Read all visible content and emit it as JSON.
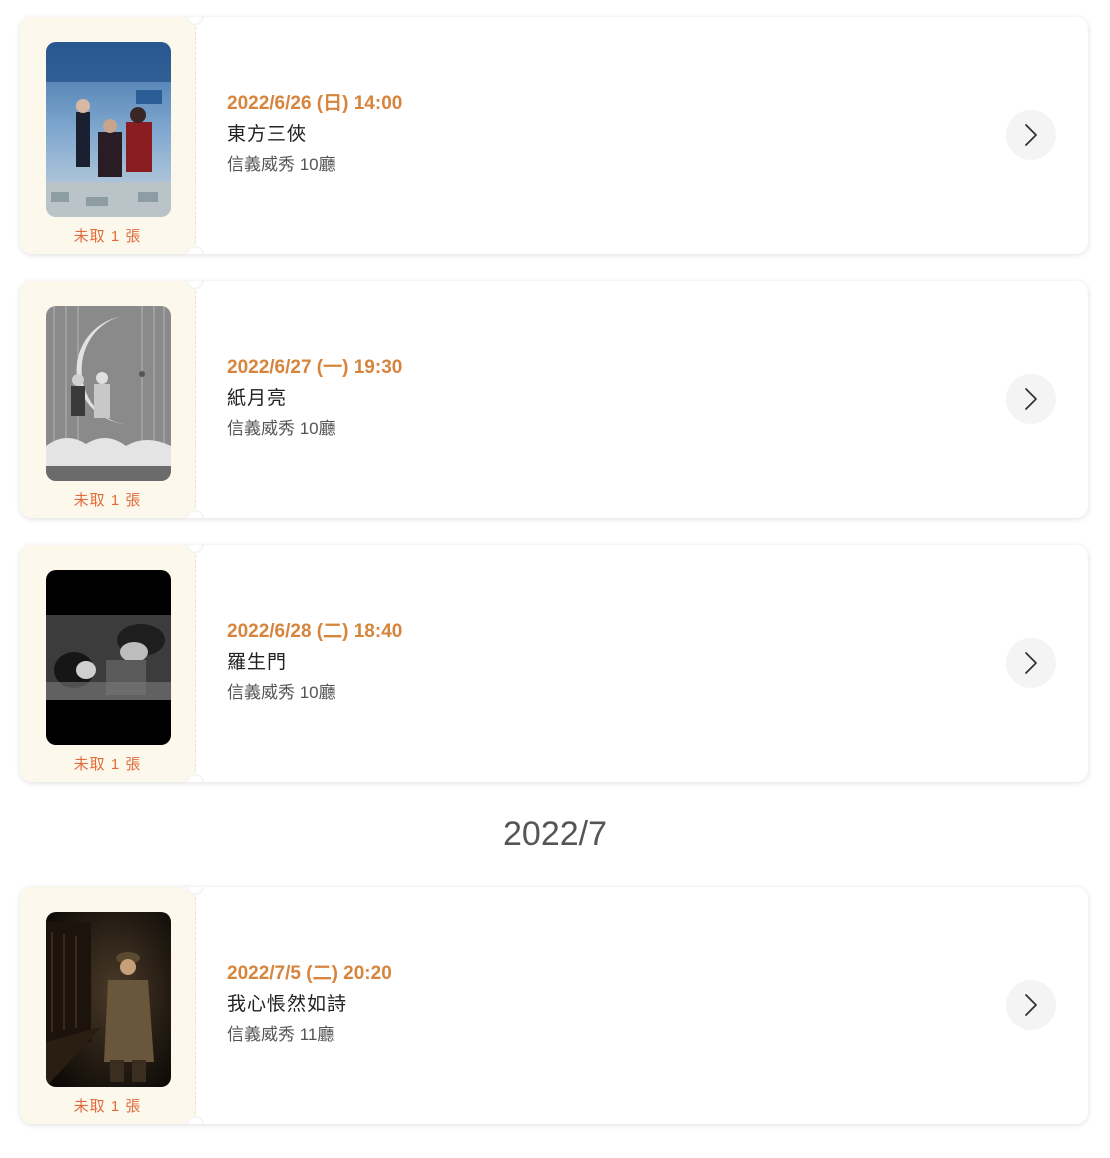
{
  "tickets_group_1": [
    {
      "datetime": "2022/6/26 (日) 14:00",
      "title": "東方三俠",
      "venue": "信義威秀 10廳",
      "pickup_status": "未取 1 張",
      "poster_icon": "movie-poster-color"
    },
    {
      "datetime": "2022/6/27 (一) 19:30",
      "title": "紙月亮",
      "venue": "信義威秀 10廳",
      "pickup_status": "未取 1 張",
      "poster_icon": "movie-poster-bw-moon"
    },
    {
      "datetime": "2022/6/28 (二) 18:40",
      "title": "羅生門",
      "venue": "信義威秀 10廳",
      "pickup_status": "未取 1 張",
      "poster_icon": "movie-poster-bw-still"
    }
  ],
  "month_heading": "2022/7",
  "tickets_group_2": [
    {
      "datetime": "2022/7/5 (二) 20:20",
      "title": "我心悵然如詩",
      "venue": "信義威秀 11廳",
      "pickup_status": "未取 1 張",
      "poster_icon": "movie-poster-dark"
    }
  ],
  "colors": {
    "datetime": "#d7843d",
    "pickup_status": "#e06b3d",
    "stub_background": "#fdf8ec"
  },
  "icons": {
    "details_arrow": "chevron-right-icon"
  }
}
